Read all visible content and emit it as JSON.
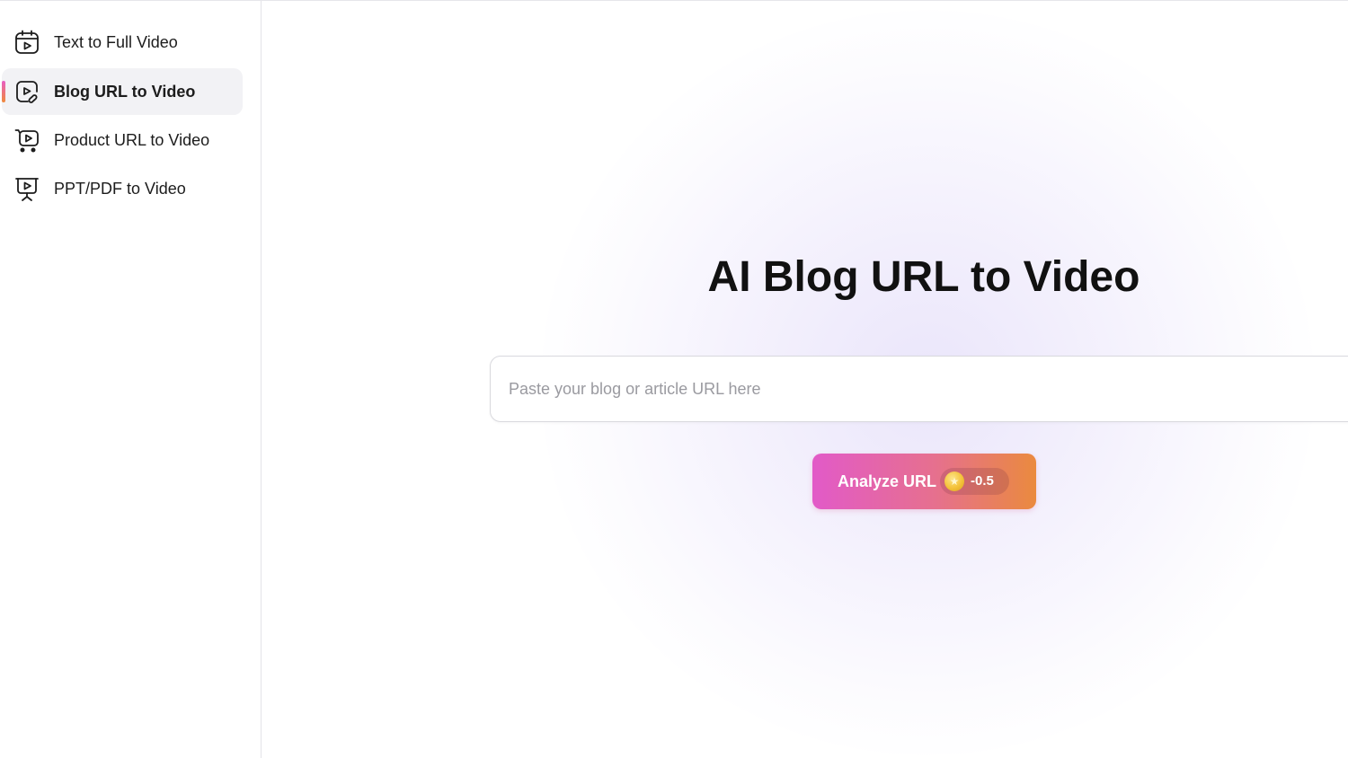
{
  "sidebar": {
    "items": [
      {
        "label": "Text to Full Video",
        "icon": "calendar-video-icon",
        "active": false
      },
      {
        "label": "Blog URL to Video",
        "icon": "video-link-icon",
        "active": true
      },
      {
        "label": "Product URL to Video",
        "icon": "cart-video-icon",
        "active": false
      },
      {
        "label": "PPT/PDF to Video",
        "icon": "presentation-video-icon",
        "active": false
      }
    ]
  },
  "main": {
    "title": "AI Blog URL to Video",
    "url_input": {
      "placeholder": "Paste your blog or article URL here",
      "value": ""
    },
    "analyze_button": {
      "label": "Analyze URL",
      "cost": "-0.5",
      "cost_icon": "coin-icon"
    }
  },
  "colors": {
    "accent_gradient_start": "#e25ac8",
    "accent_gradient_end": "#ea8a3e",
    "active_item_bg": "#f2f2f5"
  }
}
